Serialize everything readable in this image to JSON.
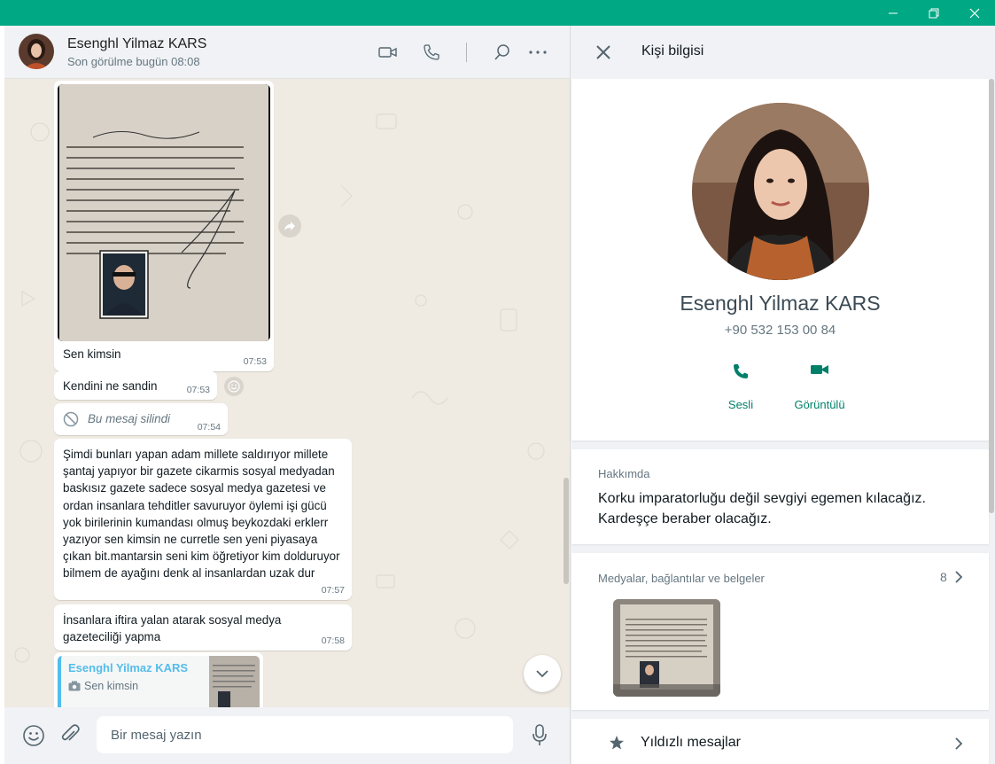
{
  "window": {
    "minimize_icon": "minimize-icon",
    "restore_icon": "restore-icon",
    "close_icon": "close-icon",
    "titlebar_color": "#00a884"
  },
  "chat_header": {
    "name": "Esenghl Yilmaz KARS",
    "status": "Son görülme bugün 08:08",
    "icons": [
      "video-call-icon",
      "voice-call-icon",
      "search-icon",
      "menu-icon"
    ]
  },
  "messages": [
    {
      "type": "image",
      "caption": "Sen kimsin",
      "time": "07:53"
    },
    {
      "type": "text",
      "text": "Kendini ne sandin",
      "time": "07:53"
    },
    {
      "type": "deleted",
      "text": "Bu mesaj silindi",
      "time": "07:54"
    },
    {
      "type": "text",
      "text": "Şimdi bunları yapan adam millete saldırıyor millete şantaj yapıyor bir gazete cikarmis sosyal medyadan baskısız gazete sadece sosyal medya gazetesi ve ordan insanlara tehditler savuruyor öylemi işi gücü yok birilerinin kumandası olmuş beykozdaki erklerr yazıyor sen kimsin ne curretle sen yeni piyasaya çıkan bit.mantarsin seni kim öğretiyor kim dolduruyor bilmem de ayağını denk al insanlardan uzak dur",
      "time": "07:57"
    },
    {
      "type": "text",
      "text": "İnsanlara iftira yalan atarak sosyal medya gazeteciliği yapma",
      "time": "07:58"
    },
    {
      "type": "quote",
      "quote_author": "Esenghl Yilmaz KARS",
      "quote_text": "Sen kimsin"
    }
  ],
  "composer": {
    "placeholder": "Bir mesaj yazın"
  },
  "contact_info": {
    "title": "Kişi bilgisi",
    "name": "Esenghl Yilmaz KARS",
    "phone": "+90 532 153 00 84",
    "actions": [
      {
        "label": "Sesli",
        "icon": "phone-icon"
      },
      {
        "label": "Görüntülü",
        "icon": "video-icon"
      }
    ],
    "about_label": "Hakkımda",
    "about_text": "Korku imparatorluğu değil sevgiyi egemen kılacağız. Kardeşçe beraber olacağız.",
    "media_label": "Medyalar, bağlantılar ve belgeler",
    "media_count": "8",
    "starred_label": "Yıldızlı mesajlar"
  },
  "colors": {
    "accent": "#008069",
    "chat_bg": "#efeae2",
    "quote_bar": "#53bdeb"
  }
}
